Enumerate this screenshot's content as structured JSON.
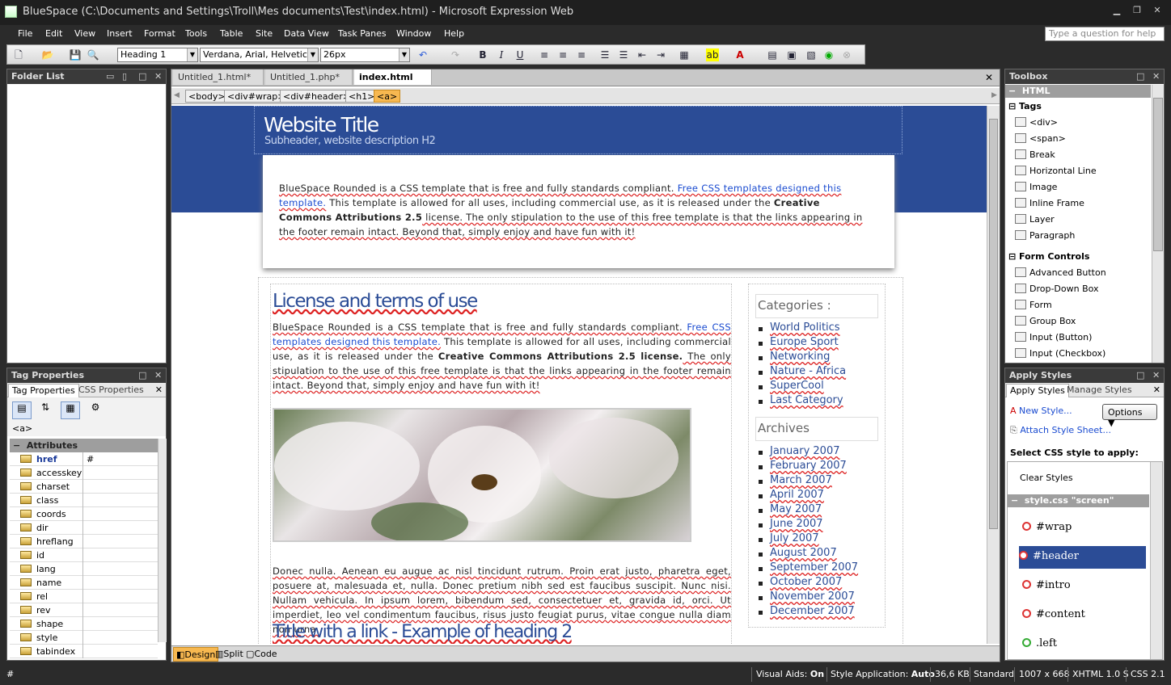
{
  "window": {
    "title": "BlueSpace (C:\\Documents and Settings\\Troll\\Mes documents\\Test\\index.html) - Microsoft Expression Web"
  },
  "menu": [
    "File",
    "Edit",
    "View",
    "Insert",
    "Format",
    "Tools",
    "Table",
    "Site",
    "Data View",
    "Task Panes",
    "Window",
    "Help"
  ],
  "ask_placeholder": "Type a question for help",
  "toolbar": {
    "style": "Heading 1",
    "font": "Verdana, Arial, Helvetica, s",
    "size": "26px"
  },
  "folder_list": {
    "title": "Folder List"
  },
  "tag_properties": {
    "title": "Tag Properties",
    "tabs": [
      "Tag Properties",
      "CSS Properties"
    ],
    "current_tag": "<a>",
    "section": "Attributes",
    "attributes": [
      {
        "name": "href",
        "value": "#"
      },
      {
        "name": "accesskey",
        "value": ""
      },
      {
        "name": "charset",
        "value": ""
      },
      {
        "name": "class",
        "value": ""
      },
      {
        "name": "coords",
        "value": ""
      },
      {
        "name": "dir",
        "value": ""
      },
      {
        "name": "hreflang",
        "value": ""
      },
      {
        "name": "id",
        "value": ""
      },
      {
        "name": "lang",
        "value": ""
      },
      {
        "name": "name",
        "value": ""
      },
      {
        "name": "rel",
        "value": ""
      },
      {
        "name": "rev",
        "value": ""
      },
      {
        "name": "shape",
        "value": ""
      },
      {
        "name": "style",
        "value": ""
      },
      {
        "name": "tabindex",
        "value": ""
      }
    ]
  },
  "doc_tabs": [
    "Untitled_1.html*",
    "Untitled_1.php*",
    "index.html"
  ],
  "breadcrumbs": [
    "<body>",
    "<div#wrap>",
    "<div#header>",
    "<h1>",
    "<a>"
  ],
  "page": {
    "site_title": "Website Title",
    "subheader": "Subheader, website description H2",
    "intro_parts": [
      "BlueSpace Rounded is a CSS template that is free and fully standards compliant. ",
      "Free CSS templates designed this template.",
      " This template is allowed for all uses, including commercial use, as it is released under the ",
      "Creative Commons Attributions 2.5",
      " license. The only stipulation to the use of this free template is that the links appearing in the footer remain intact. Beyond that, simply enjoy and have fun with it!"
    ],
    "heading1": "License and terms of use",
    "body1_parts": [
      "BlueSpace Rounded is a CSS template that is free and fully standards compliant. ",
      "Free CSS templates designed this template.",
      " This template is allowed for all uses, including commercial use, as it is released under the ",
      "Creative Commons Attributions 2.5 license.",
      " The only stipulation to the use of this free template is that the links appearing in the footer remain intact. Beyond that, simply enjoy and have fun with it!"
    ],
    "body2": "Donec nulla. Aenean eu augue ac nisl tincidunt rutrum. Proin erat justo, pharetra eget, posuere at, malesuada et, nulla. Donec pretium nibh sed est faucibus suscipit. Nunc nisi. Nullam vehicula. In ipsum lorem, bibendum sed, consectetuer et, gravida id, orci. Ut imperdiet, leo vel condimentum faucibus, risus justo feugiat purus, vitae congue nulla diam non urna.",
    "heading2": "Title with a link - Example of heading 2",
    "categories_title": "Categories :",
    "categories": [
      "World Politics",
      "Europe Sport",
      "Networking",
      "Nature - Africa",
      "SuperCool",
      "Last Category"
    ],
    "archives_title": "Archives",
    "archives": [
      "January 2007",
      "February 2007",
      "March 2007",
      "April 2007",
      "May 2007",
      "June 2007",
      "July 2007",
      "August 2007",
      "September 2007",
      "October 2007",
      "November 2007",
      "December 2007"
    ]
  },
  "view_tabs": [
    "Design",
    "Split",
    "Code"
  ],
  "toolbox": {
    "title": "Toolbox",
    "html_label": "HTML",
    "tags_label": "Tags",
    "tags": [
      "<div>",
      "<span>",
      "Break",
      "Horizontal Line",
      "Image",
      "Inline Frame",
      "Layer",
      "Paragraph"
    ],
    "form_label": "Form Controls",
    "form_controls": [
      "Advanced Button",
      "Drop-Down Box",
      "Form",
      "Group Box",
      "Input (Button)",
      "Input (Checkbox)"
    ]
  },
  "apply_styles": {
    "title": "Apply Styles",
    "tabs": [
      "Apply Styles",
      "Manage Styles"
    ],
    "new_style": "New Style...",
    "options": "Options",
    "attach": "Attach Style Sheet...",
    "select_label": "Select CSS style to apply:",
    "clear": "Clear Styles",
    "sheet": "style.css \"screen\"",
    "styles": [
      "#wrap",
      "#header",
      "#intro",
      "#content",
      ".left"
    ]
  },
  "status": {
    "visual_aids_label": "Visual Aids:",
    "visual_aids": "On",
    "style_app_label": "Style Application:",
    "style_app": "Auto",
    "size": "36,6 KB",
    "mode": "Standard",
    "dims": "1007 x 668",
    "doctype": "XHTML 1.0 S",
    "css": "CSS 2.1"
  },
  "colors": {
    "accent": "#2b4c96",
    "highlight": "#f7b850",
    "link": "#1a4bd0"
  }
}
